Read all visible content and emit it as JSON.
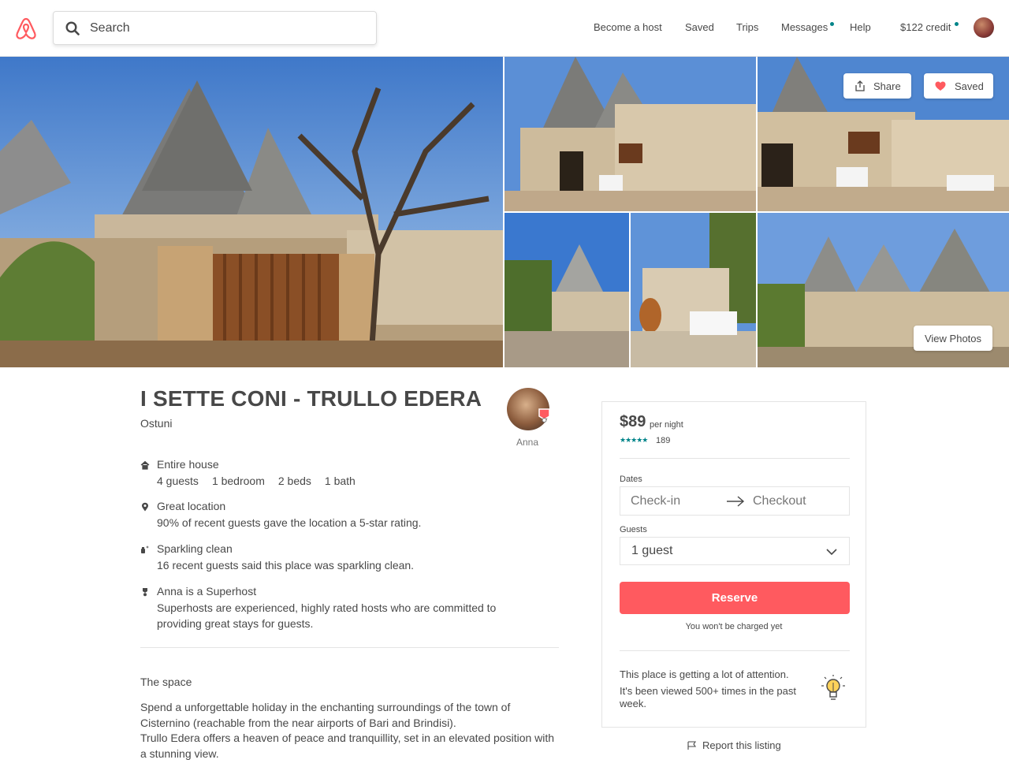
{
  "header": {
    "search_placeholder": "Search",
    "nav": {
      "become_host": "Become a host",
      "saved": "Saved",
      "trips": "Trips",
      "messages": "Messages",
      "help": "Help",
      "credit": "$122 credit"
    }
  },
  "photos": {
    "share_label": "Share",
    "saved_label": "Saved",
    "view_photos_label": "View Photos"
  },
  "listing": {
    "title": "I SETTE CONI - TRULLO EDERA",
    "city": "Ostuni",
    "host_name": "Anna",
    "features": [
      {
        "heading": "Entire house",
        "icon": "home-icon",
        "details": [
          "4 guests",
          "1 bedroom",
          "2 beds",
          "1 bath"
        ]
      },
      {
        "heading": "Great location",
        "icon": "location-pin-icon",
        "description": "90% of recent guests gave the location a 5-star rating."
      },
      {
        "heading": "Sparkling clean",
        "icon": "sparkle-icon",
        "description": "16 recent guests said this place was sparkling clean."
      },
      {
        "heading": "Anna is a Superhost",
        "icon": "medal-icon",
        "description": "Superhosts are experienced, highly rated hosts who are committed to providing great stays for guests."
      }
    ],
    "space_heading": "The space",
    "space_text_1": "Spend a unforgettable holiday in the enchanting surroundings of the town of Cisternino (reachable from the near airports of Bari and Brindisi).",
    "space_text_2": "Trullo Edera offers a heaven of peace and tranquillity, set in an elevated position with a stunning view."
  },
  "booking": {
    "price": "$89",
    "per_night": "per night",
    "stars": "★★★★★",
    "review_count": "189",
    "dates_label": "Dates",
    "checkin_placeholder": "Check-in",
    "checkout_placeholder": "Checkout",
    "guests_label": "Guests",
    "guests_value": "1 guest",
    "reserve_label": "Reserve",
    "no_charge_note": "You won't be charged yet",
    "attention_heading": "This place is getting a lot of attention.",
    "attention_text": "It's been viewed 500+ times in the past week.",
    "report_label": "Report this listing"
  },
  "colors": {
    "brand": "#ff5a5f",
    "accent": "#008489",
    "text": "#484848"
  }
}
